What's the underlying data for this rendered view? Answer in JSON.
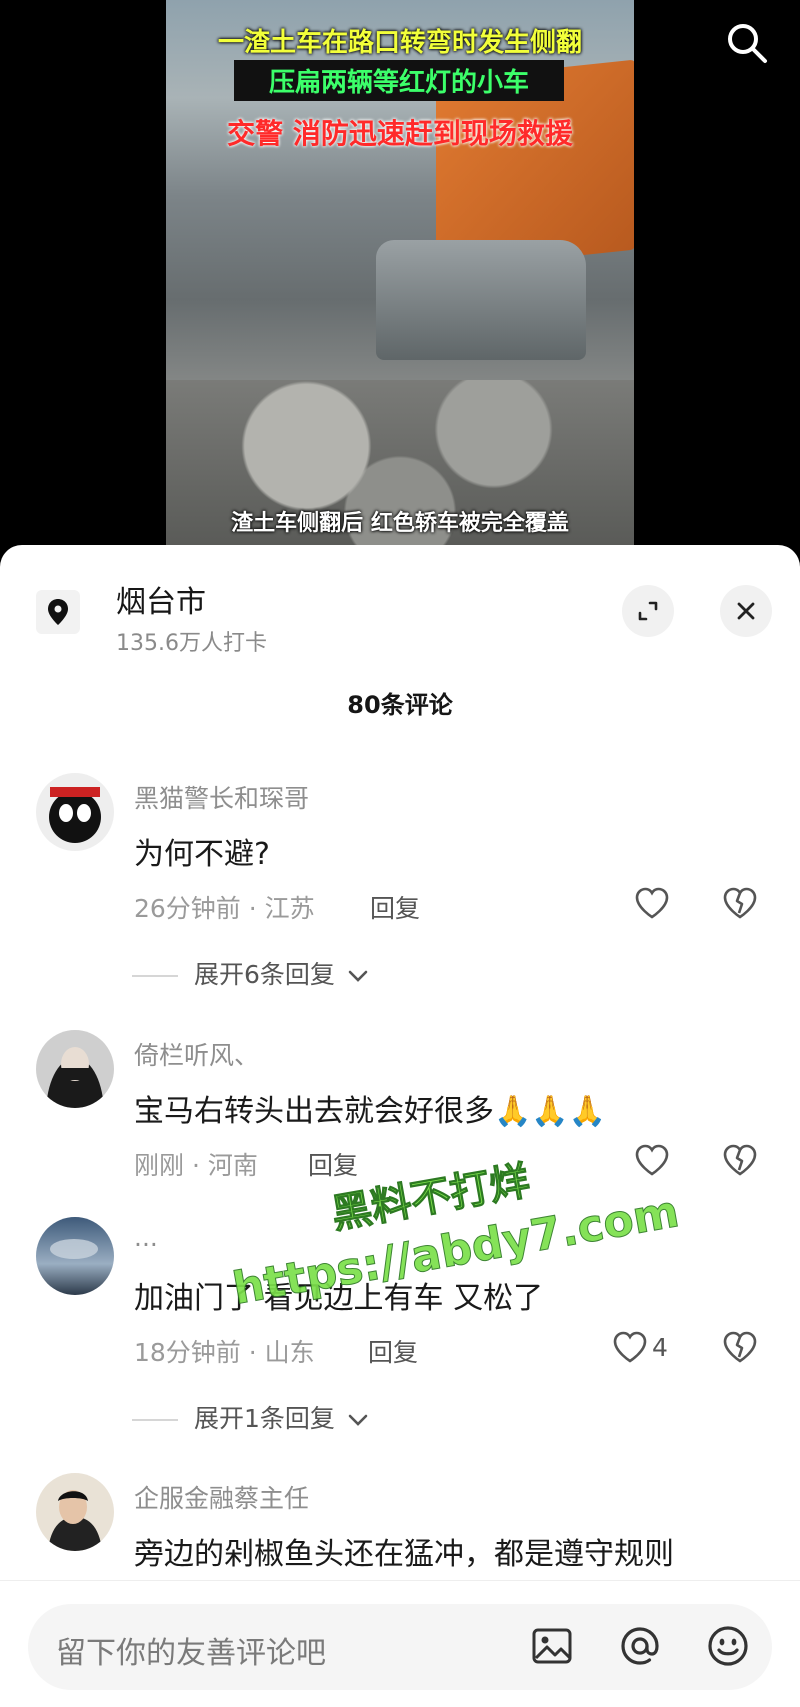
{
  "video": {
    "caption_line1": "一渣土车在路口转弯时发生侧翻",
    "caption_line2": "压扁两辆等红灯的小车",
    "caption_line3": "交警 消防迅速赶到现场救援",
    "caption_bottom": "渣土车侧翻后 红色轿车被完全覆盖"
  },
  "location": {
    "title": "烟台市",
    "subtitle": "135.6万人打卡"
  },
  "comments_count": "80条评论",
  "comments": [
    {
      "username": "黑猫警长和琛哥",
      "text": "为何不避?",
      "meta": "26分钟前 · 江苏",
      "reply": "回复",
      "expand": "展开6条回复"
    },
    {
      "username": "倚栏听风、",
      "text": "宝马右转头出去就会好很多🙏🙏🙏",
      "meta": "刚刚 · 河南",
      "reply": "回复"
    },
    {
      "username": "...",
      "text": "加油门了 看见边上有车 又松了",
      "meta": "18分钟前 · 山东",
      "reply": "回复",
      "likes": "4",
      "expand": "展开1条回复"
    },
    {
      "username": "企服金融蔡主任",
      "text": "旁边的剁椒鱼头还在猛冲，都是遵守规则"
    }
  ],
  "watermark": {
    "line1": "黑料不打烊",
    "line2": "https://abdy7.com"
  },
  "composer": {
    "placeholder": "留下你的友善评论吧"
  },
  "icons": [
    "search-icon",
    "location-pin-icon",
    "expand-icon",
    "close-icon",
    "heart-icon",
    "broken-heart-icon",
    "chevron-down-icon",
    "image-icon",
    "at-icon",
    "emoji-icon"
  ]
}
